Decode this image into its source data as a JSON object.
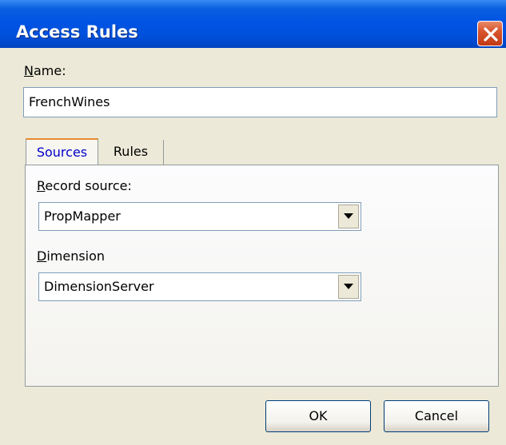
{
  "window": {
    "title": "Access Rules"
  },
  "name_field": {
    "label_underlined": "N",
    "label_rest": "ame:",
    "value": "FrenchWines"
  },
  "tabs": [
    {
      "label": "Sources",
      "selected": true
    },
    {
      "label": "Rules",
      "selected": false
    }
  ],
  "sources_tab": {
    "record_source": {
      "label_underlined": "R",
      "label_rest": "ecord source:",
      "value": "PropMapper"
    },
    "dimension": {
      "label_underlined": "D",
      "label_rest": "imension",
      "value": "DimensionServer"
    }
  },
  "buttons": {
    "ok": "OK",
    "cancel": "Cancel"
  },
  "icons": {
    "close": "close-icon",
    "dropdown": "chevron-down-icon"
  },
  "colors": {
    "titlebar": "#0054e3",
    "dialog_bg": "#ece9d8",
    "close_button": "#d8552e",
    "selected_tab_text": "#0000cc",
    "selected_tab_accent": "#e68b2c"
  }
}
